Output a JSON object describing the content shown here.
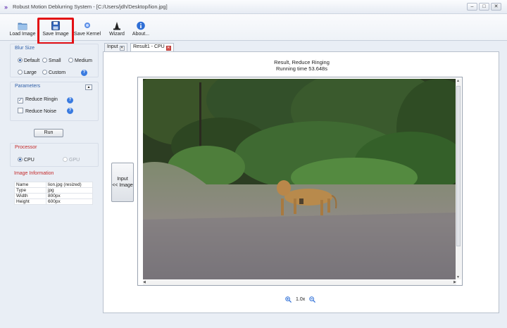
{
  "window": {
    "title": "Robust Motion Deblurring System - [C:/Users/jdh/Desktop/lion.jpg]",
    "controls": [
      "–",
      "□",
      "✕"
    ]
  },
  "toolbar": {
    "load": "Load Image",
    "save": "Save Image",
    "save_kernel": "Save Kernel",
    "wizard": "Wizard",
    "about": "About..."
  },
  "blur_size": {
    "title": "Blur Size",
    "default": "Default",
    "small": "Small",
    "medium": "Medium",
    "large": "Large",
    "custom": "Custom",
    "selected": "Default"
  },
  "parameters": {
    "title": "Parameters",
    "reduce_ringing": "Reduce Ringin",
    "reduce_ringing_checked": true,
    "reduce_noise": "Reduce Noise",
    "reduce_noise_checked": false
  },
  "run_label": "Run",
  "processor": {
    "title": "Processor",
    "cpu": "CPU",
    "gpu": "GPU",
    "selected": "CPU"
  },
  "image_info": {
    "title": "Image Information",
    "rows": [
      {
        "key": "Name",
        "value": "lion.jpg (resized)"
      },
      {
        "key": "Type",
        "value": "jpg"
      },
      {
        "key": "Width",
        "value": "800px"
      },
      {
        "key": "Height",
        "value": "600px"
      }
    ]
  },
  "tabs": [
    {
      "label": "Input"
    },
    {
      "label": "Result1 - CPU"
    }
  ],
  "result": {
    "title": "Result, Reduce Ringing",
    "time": "Running time 53.648s"
  },
  "input_button": {
    "line1": "Input",
    "line2": "<< Image"
  },
  "zoom": {
    "level": "1.0x"
  },
  "colors": {
    "highlight": "#e30f14",
    "accent": "#2f5fa8"
  }
}
